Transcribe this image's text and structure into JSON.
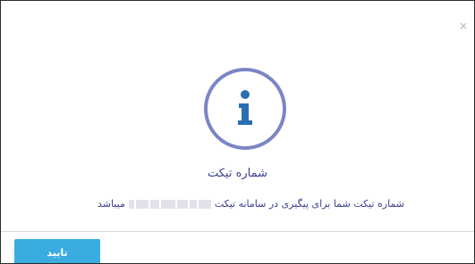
{
  "dialog": {
    "close_glyph": "×",
    "icon": "info-icon",
    "title": "شماره تیکت",
    "message_before": "شماره تیکت شما برای پیگیری در سامانه تیکت ",
    "message_after": "میباشد",
    "ok_label": "تایید"
  },
  "colors": {
    "accent": "#3aace0",
    "text": "#3a3f8f",
    "icon_ring": "#7a86c4",
    "icon_glyph": "#2b6fb3"
  }
}
